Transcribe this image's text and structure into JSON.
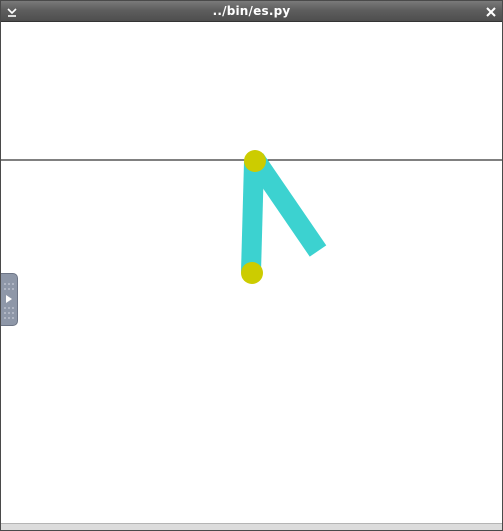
{
  "window": {
    "title": "../bin/es.py",
    "menu_icon": "chevron-down-icon",
    "close_icon": "close-icon"
  },
  "scene": {
    "line_color": "#000000",
    "link_color": "#3cd2d0",
    "joint_color": "#cccc00",
    "background": "#ffffff"
  },
  "side_panel": {
    "icon": "play-icon"
  }
}
